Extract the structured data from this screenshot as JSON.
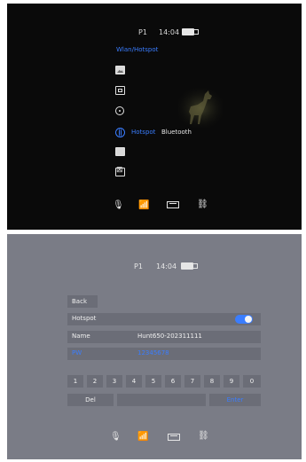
{
  "screen1": {
    "status": {
      "profile": "P1",
      "time": "14:04"
    },
    "section_title": "Wlan/Hotspot",
    "menu": {
      "options": [
        "Hotspot",
        "Bluetooth"
      ]
    },
    "bottom_icons": [
      "mic-icon",
      "wifi-icon",
      "battery-meter-icon",
      "link-icon"
    ],
    "colors": {
      "accent": "#3a7dff",
      "background": "#0a0a0a"
    }
  },
  "screen2": {
    "status": {
      "profile": "P1",
      "time": "14:04"
    },
    "back_label": "Back",
    "hotspot": {
      "label": "Hotspot",
      "enabled": true
    },
    "name": {
      "label": "Name",
      "value": "Hunt650-202311111"
    },
    "password": {
      "label": "PW",
      "value": "12345678"
    },
    "keypad": {
      "digits": [
        "1",
        "2",
        "3",
        "4",
        "5",
        "6",
        "7",
        "8",
        "9",
        "0"
      ],
      "del_label": "Del",
      "enter_label": "Enter"
    },
    "bottom_icons": [
      "mic-icon",
      "wifi-icon",
      "battery-meter-icon",
      "link-icon"
    ],
    "colors": {
      "accent": "#3a7dff",
      "background": "#7a7c86",
      "row": "#6b6d77"
    }
  }
}
